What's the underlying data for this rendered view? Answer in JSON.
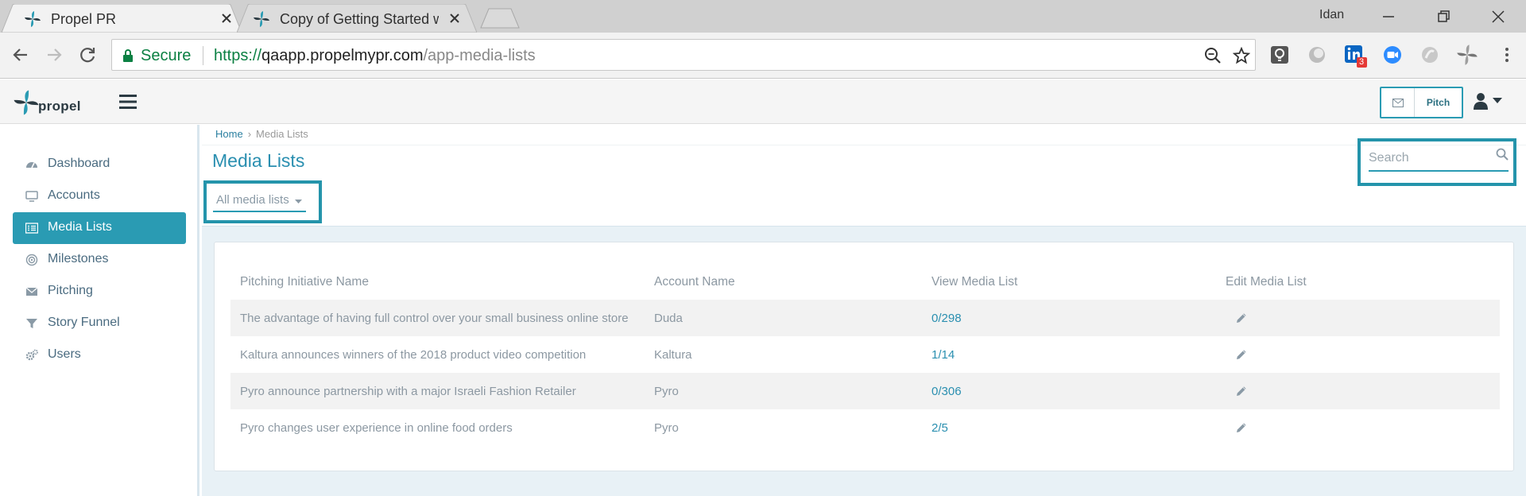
{
  "browser": {
    "tabs": [
      {
        "title": "Propel PR",
        "active": true
      },
      {
        "title": "Copy of Getting Started w",
        "active": false
      }
    ],
    "profile_name": "Idan",
    "secure_label": "Secure",
    "url_scheme": "https://",
    "url_host": "qaapp.propelmypr.com",
    "url_path": "/app-media-lists",
    "extensions": [
      "lightbulb-extension-icon",
      "circle-extension-icon",
      "linkedin-extension-icon",
      "zoom-extension-icon",
      "gray-extension-icon",
      "propel-extension-icon"
    ],
    "linkedin_badge": "3"
  },
  "header": {
    "logo_text": "propel",
    "pitch_label": "Pitch"
  },
  "sidebar": {
    "items": [
      {
        "label": "Dashboard",
        "icon": "dashboard-icon",
        "active": false
      },
      {
        "label": "Accounts",
        "icon": "monitor-icon",
        "active": false
      },
      {
        "label": "Media Lists",
        "icon": "list-icon",
        "active": true
      },
      {
        "label": "Milestones",
        "icon": "target-icon",
        "active": false
      },
      {
        "label": "Pitching",
        "icon": "envelope-icon",
        "active": false
      },
      {
        "label": "Story Funnel",
        "icon": "funnel-icon",
        "active": false
      },
      {
        "label": "Users",
        "icon": "gears-icon",
        "active": false
      }
    ]
  },
  "main": {
    "breadcrumb": {
      "home": "Home",
      "separator": "›",
      "current": "Media Lists"
    },
    "title": "Media Lists",
    "filter_label": "All media lists",
    "search_placeholder": "Search",
    "table": {
      "columns": [
        "Pitching Initiative Name",
        "Account Name",
        "View Media List",
        "Edit Media List"
      ],
      "rows": [
        {
          "name": "The advantage of having full control over your small business online store",
          "account": "Duda",
          "view": "0/298"
        },
        {
          "name": "Kaltura announces winners of the 2018 product video competition",
          "account": "Kaltura",
          "view": "1/14"
        },
        {
          "name": "Pyro announce partnership with a major Israeli Fashion Retailer",
          "account": "Pyro",
          "view": "0/306"
        },
        {
          "name": "Pyro changes user experience in online food orders",
          "account": "Pyro",
          "view": "2/5"
        }
      ]
    }
  },
  "colors": {
    "accent": "#2a9bb3",
    "highlight_box": "#2494ab",
    "title": "#2a8fb0",
    "muted_text": "#8c98a2"
  }
}
